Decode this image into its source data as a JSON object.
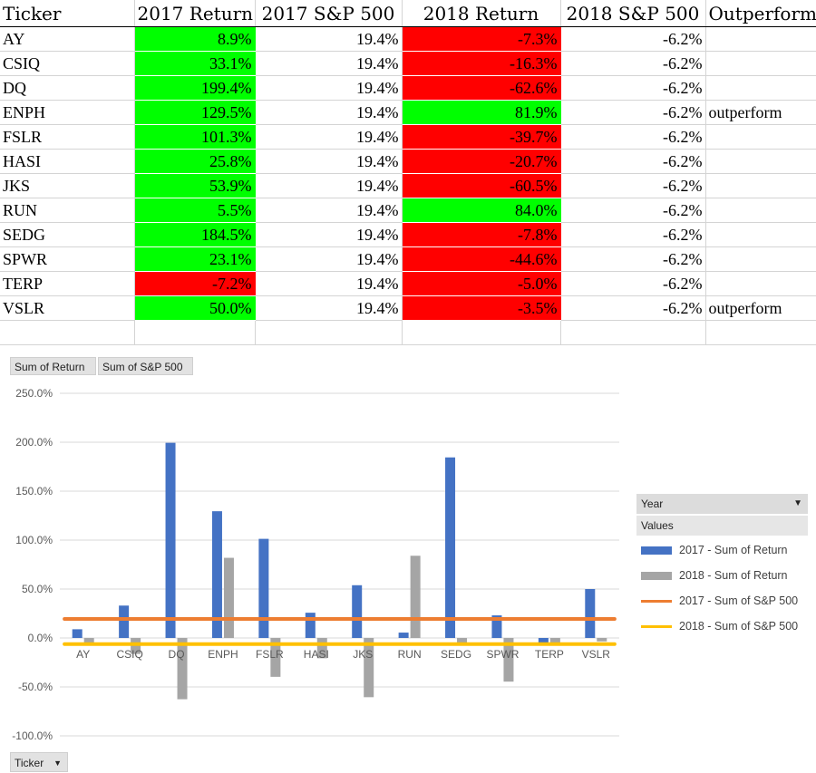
{
  "table": {
    "headers": [
      "Ticker",
      "2017 Return",
      "2017 S&P 500",
      "2018 Return",
      "2018 S&P 500",
      "Outperform"
    ],
    "rows": [
      {
        "ticker": "AY",
        "r2017": "8.9%",
        "sp2017": "19.4%",
        "r2018": "-7.3%",
        "sp2018": "-6.2%",
        "outperform": ""
      },
      {
        "ticker": "CSIQ",
        "r2017": "33.1%",
        "sp2017": "19.4%",
        "r2018": "-16.3%",
        "sp2018": "-6.2%",
        "outperform": ""
      },
      {
        "ticker": "DQ",
        "r2017": "199.4%",
        "sp2017": "19.4%",
        "r2018": "-62.6%",
        "sp2018": "-6.2%",
        "outperform": ""
      },
      {
        "ticker": "ENPH",
        "r2017": "129.5%",
        "sp2017": "19.4%",
        "r2018": "81.9%",
        "sp2018": "-6.2%",
        "outperform": "outperform"
      },
      {
        "ticker": "FSLR",
        "r2017": "101.3%",
        "sp2017": "19.4%",
        "r2018": "-39.7%",
        "sp2018": "-6.2%",
        "outperform": ""
      },
      {
        "ticker": "HASI",
        "r2017": "25.8%",
        "sp2017": "19.4%",
        "r2018": "-20.7%",
        "sp2018": "-6.2%",
        "outperform": ""
      },
      {
        "ticker": "JKS",
        "r2017": "53.9%",
        "sp2017": "19.4%",
        "r2018": "-60.5%",
        "sp2018": "-6.2%",
        "outperform": ""
      },
      {
        "ticker": "RUN",
        "r2017": "5.5%",
        "sp2017": "19.4%",
        "r2018": "84.0%",
        "sp2018": "-6.2%",
        "outperform": ""
      },
      {
        "ticker": "SEDG",
        "r2017": "184.5%",
        "sp2017": "19.4%",
        "r2018": "-7.8%",
        "sp2018": "-6.2%",
        "outperform": ""
      },
      {
        "ticker": "SPWR",
        "r2017": "23.1%",
        "sp2017": "19.4%",
        "r2018": "-44.6%",
        "sp2018": "-6.2%",
        "outperform": ""
      },
      {
        "ticker": "TERP",
        "r2017": "-7.2%",
        "sp2017": "19.4%",
        "r2018": "-5.0%",
        "sp2018": "-6.2%",
        "outperform": ""
      },
      {
        "ticker": "VSLR",
        "r2017": "50.0%",
        "sp2017": "19.4%",
        "r2018": "-3.5%",
        "sp2018": "-6.2%",
        "outperform": "outperform"
      }
    ]
  },
  "pivot": {
    "value_buttons": [
      "Sum of Return",
      "Sum of S&P 500"
    ],
    "axis_button": "Ticker",
    "legend_field": "Year",
    "legend_values_label": "Values"
  },
  "colors": {
    "positive": "#00ff00",
    "negative": "#ff0000",
    "series_2017_return": "#4472c4",
    "series_2018_return": "#a5a5a5",
    "series_2017_sp": "#ed7d31",
    "series_2018_sp": "#ffc000"
  },
  "chart_data": {
    "type": "bar",
    "categories": [
      "AY",
      "CSIQ",
      "DQ",
      "ENPH",
      "FSLR",
      "HASI",
      "JKS",
      "RUN",
      "SEDG",
      "SPWR",
      "TERP",
      "VSLR"
    ],
    "series": [
      {
        "name": "2017 - Sum of Return",
        "kind": "bar",
        "color": "#4472c4",
        "values": [
          8.9,
          33.1,
          199.4,
          129.5,
          101.3,
          25.8,
          53.9,
          5.5,
          184.5,
          23.1,
          -7.2,
          50.0
        ]
      },
      {
        "name": "2018 - Sum of Return",
        "kind": "bar",
        "color": "#a5a5a5",
        "values": [
          -7.3,
          -16.3,
          -62.6,
          81.9,
          -39.7,
          -20.7,
          -60.5,
          84.0,
          -7.8,
          -44.6,
          -5.0,
          -3.5
        ]
      },
      {
        "name": "2017 - Sum of S&P 500",
        "kind": "line",
        "color": "#ed7d31",
        "values": [
          19.4,
          19.4,
          19.4,
          19.4,
          19.4,
          19.4,
          19.4,
          19.4,
          19.4,
          19.4,
          19.4,
          19.4
        ]
      },
      {
        "name": "2018 - Sum of S&P 500",
        "kind": "line",
        "color": "#ffc000",
        "values": [
          -6.2,
          -6.2,
          -6.2,
          -6.2,
          -6.2,
          -6.2,
          -6.2,
          -6.2,
          -6.2,
          -6.2,
          -6.2,
          -6.2
        ]
      }
    ],
    "y_ticks": [
      "250.0%",
      "200.0%",
      "150.0%",
      "100.0%",
      "50.0%",
      "0.0%",
      "-50.0%",
      "-100.0%"
    ],
    "ylim": [
      -100,
      250
    ],
    "unit": "%",
    "grid": true,
    "legend_position": "right"
  }
}
